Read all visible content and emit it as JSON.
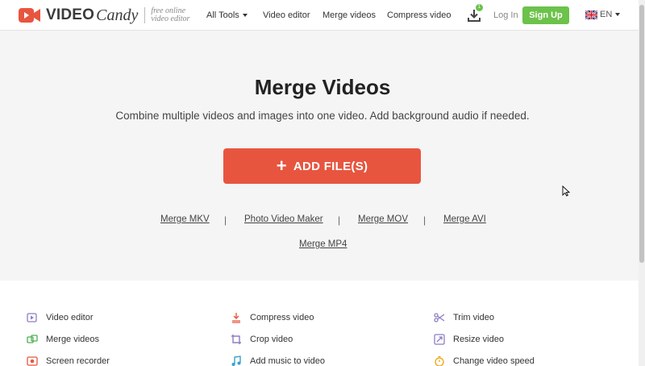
{
  "header": {
    "logo_video": "VIDEO",
    "logo_candy": "Candy",
    "tagline_line1": "free online",
    "tagline_line2": "video editor",
    "nav": {
      "all_tools": "All Tools",
      "video_editor": "Video editor",
      "merge_videos": "Merge videos",
      "compress_video": "Compress video"
    },
    "download_badge": "1",
    "login": "Log In",
    "signup": "Sign Up",
    "lang": "EN"
  },
  "hero": {
    "title": "Merge Videos",
    "subtitle": "Combine multiple videos and images into one video. Add background audio if needed.",
    "add_button": "ADD FILE(S)",
    "links": {
      "merge_mkv": "Merge MKV",
      "photo_video_maker": "Photo Video Maker",
      "merge_mov": "Merge MOV",
      "merge_avi": "Merge AVI",
      "merge_mp4": "Merge MP4"
    },
    "separator": "|"
  },
  "tools": {
    "col1": [
      "Video editor",
      "Merge videos",
      "Screen recorder"
    ],
    "col2": [
      "Compress video",
      "Crop video",
      "Add music to video"
    ],
    "col3": [
      "Trim video",
      "Resize video",
      "Change video speed"
    ]
  },
  "colors": {
    "brand_orange": "#e8553f",
    "signup_green": "#6cc24a"
  }
}
